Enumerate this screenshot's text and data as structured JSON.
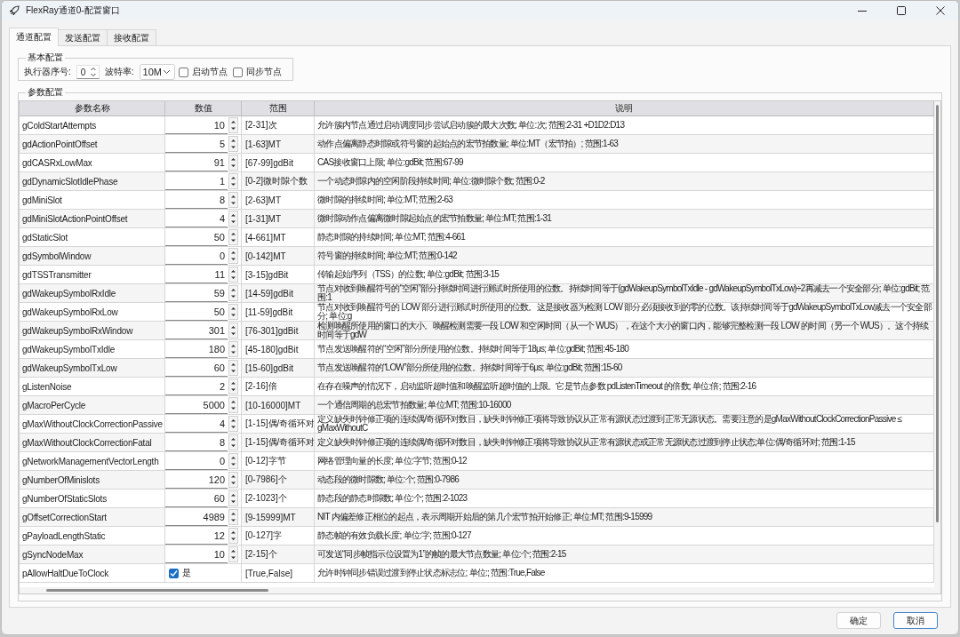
{
  "window": {
    "title": "FlexRay通道0-配置窗口"
  },
  "tabs": [
    {
      "label": "通道配置",
      "selected": true
    },
    {
      "label": "发送配置",
      "selected": false
    },
    {
      "label": "接收配置",
      "selected": false
    }
  ],
  "basic_config": {
    "title": "基本配置",
    "executor_label": "执行器序号:",
    "executor_value": "0",
    "baud_label": "波特率:",
    "baud_value": "10M",
    "checkboxes": [
      {
        "label": "启动节点",
        "checked": false
      },
      {
        "label": "同步节点",
        "checked": false
      }
    ]
  },
  "params": {
    "title": "参数配置",
    "columns": [
      "参数名称",
      "数值",
      "范围",
      "说明"
    ],
    "rows": [
      {
        "kind": "number",
        "name": "gColdStartAttempts",
        "value": "10",
        "range": "[2-31]次",
        "description": "允许簇内节点通过启动调度同步尝试启动簇的最大次数; 单位:次; 范围:2-31 +D1D2:D13"
      },
      {
        "kind": "number",
        "name": "gdActionPointOffset",
        "value": "5",
        "range": "[1-63]MT",
        "description": "动作点偏离静态时隙或符号窗的起始点的宏节拍数量; 单位:MT（宏节拍）; 范围:1-63"
      },
      {
        "kind": "number",
        "name": "gdCASRxLowMax",
        "value": "91",
        "range": "[67-99]gdBit",
        "description": "CAS接收窗口上限; 单位:gdBit; 范围:67-99"
      },
      {
        "kind": "number",
        "name": "gdDynamicSlotIdlePhase",
        "value": "1",
        "range": "[0-2]微时隙个数",
        "description": "一个动态时隙内的空闲阶段持续时间; 单位:微时隙个数; 范围:0-2"
      },
      {
        "kind": "number",
        "name": "gdMiniSlot",
        "value": "8",
        "range": "[2-63]MT",
        "description": "微时隙的持续时间; 单位:MT; 范围:2-63"
      },
      {
        "kind": "number",
        "name": "gdMiniSlotActionPointOffset",
        "value": "4",
        "range": "[1-31]MT",
        "description": "微时隙动作点偏离微时隙起始点的宏节拍数量; 单位:MT; 范围:1-31"
      },
      {
        "kind": "number",
        "name": "gdStaticSlot",
        "value": "50",
        "range": "[4-661]MT",
        "description": "静态时隙的持续时间; 单位:MT; 范围:4-661"
      },
      {
        "kind": "number",
        "name": "gdSymbolWindow",
        "value": "0",
        "range": "[0-142]MT",
        "description": "符号窗的持续时间; 单位:MT; 范围:0-142"
      },
      {
        "kind": "number",
        "name": "gdTSSTransmitter",
        "value": "11",
        "range": "[3-15]gdBit",
        "description": "传输起始序列（TSS）的位数; 单位:gdBit; 范围:3-15"
      },
      {
        "kind": "number",
        "name": "gdWakeupSymbolRxIdle",
        "value": "59",
        "range": "[14-59]gdBit",
        "description": "节点对收到唤醒符号的“空闲”部分持续时间进行测试时所使用的位数。持续时间等于(gdWakeupSymbolTxIdle - gdWakeupSymbolTxLow)÷2再减去一个安全部分; 单位:gdBit; 范围:1"
      },
      {
        "kind": "number",
        "name": "gdWakeupSymbolRxLow",
        "value": "50",
        "range": "[11-59]gdBit",
        "description": "节点对收到唤醒符号的 LOW 部分进行测试时所使用的位数。这是接收器为检测 LOW 部分必须接收到的零的位数。该持续时间等于gdWakeupSymbolTxLow减去一个安全部分; 单位:g"
      },
      {
        "kind": "number",
        "name": "gdWakeupSymbolRxWindow",
        "value": "301",
        "range": "[76-301]gdBit",
        "description": "检测唤醒所使用的窗口的大小。唤醒检测需要一段 LOW 和空闲时间（从一个 WUS），在这个大小的窗口内，能够完整检测一段 LOW 的时间（另一个 WUS）。这个持续时间等于gdW"
      },
      {
        "kind": "number",
        "name": "gdWakeupSymbolTxIdle",
        "value": "180",
        "range": "[45-180]gdBit",
        "description": "节点发送唤醒符的“空闲”部分所使用的位数。持续时间等于18μs; 单位:gdBit; 范围:45-180"
      },
      {
        "kind": "number",
        "name": "gdWakeupSymbolTxLow",
        "value": "60",
        "range": "[15-60]gdBit",
        "description": "节点发送唤醒符的“LOW”部分所使用的位数。持续时间等于6μs; 单位:gdBit; 范围:15-60"
      },
      {
        "kind": "number",
        "name": "gListenNoise",
        "value": "2",
        "range": "[2-16]倍",
        "description": "在存在噪声的情况下，启动监听超时值和唤醒监听超时值的上限。它是节点参数 pdListenTimeout 的倍数; 单位:倍; 范围:2-16"
      },
      {
        "kind": "number",
        "name": "gMacroPerCycle",
        "value": "5000",
        "range": "[10-16000]MT",
        "description": "一个通信周期的总宏节拍数量; 单位:MT; 范围:10-16000"
      },
      {
        "kind": "number",
        "name": "gMaxWithoutClockCorrectionPassive",
        "value": "4",
        "range": "[1-15]偶/奇循环对",
        "description": "定义缺失时钟修正项的连续偶/奇循环对数目，缺失时钟修正项将导致协议从正常有源状态过渡到正常无源状态。需要注意的是gMaxWithoutClockCorrectionPassive ≤ gMaxWithoutC"
      },
      {
        "kind": "number",
        "name": "gMaxWithoutClockCorrectionFatal",
        "value": "8",
        "range": "[1-15]偶/奇循环对",
        "description": "定义缺失时钟修正项的连续偶/奇循环对数目，缺失时钟修正项将导致协议从正常有源状态或正常无源状态过渡到停止状态;单位:偶/奇循环对; 范围:1-15"
      },
      {
        "kind": "number",
        "name": "gNetworkManagementVectorLength",
        "value": "0",
        "range": "[0-12]字节",
        "description": "网络管理向量的长度; 单位:字节; 范围:0-12"
      },
      {
        "kind": "number",
        "name": "gNumberOfMinislots",
        "value": "120",
        "range": "[0-7986]个",
        "description": "动态段的微时隙数; 单位:个; 范围:0-7986"
      },
      {
        "kind": "number",
        "name": "gNumberOfStaticSlots",
        "value": "60",
        "range": "[2-1023]个",
        "description": "静态段的静态时隙数; 单位:个; 范围:2-1023"
      },
      {
        "kind": "number",
        "name": "gOffsetCorrectionStart",
        "value": "4989",
        "range": "[9-15999]MT",
        "description": "NIT 内偏差修正相位的起点，表示周期开始后的第几个宏节拍开始修正; 单位:MT; 范围:9-15999"
      },
      {
        "kind": "number",
        "name": "gPayloadLengthStatic",
        "value": "12",
        "range": "[0-127]字",
        "description": "静态帧的有效负载长度; 单位:字; 范围:0-127"
      },
      {
        "kind": "number",
        "name": "gSyncNodeMax",
        "value": "10",
        "range": "[2-15]个",
        "description": "可发送“同步帧指示位设置为1”的帧的最大节点数量; 单位:个; 范围:2-15"
      },
      {
        "kind": "bool",
        "name": "pAllowHaltDueToClock",
        "checked": true,
        "value": "是",
        "range": "[True,False]",
        "description": "允许时钟同步错误过渡到停止状态标志位; 单位:; 范围:True,False"
      }
    ]
  },
  "buttons": [
    {
      "label": "确定",
      "default": false
    },
    {
      "label": "取消",
      "default": true
    }
  ]
}
